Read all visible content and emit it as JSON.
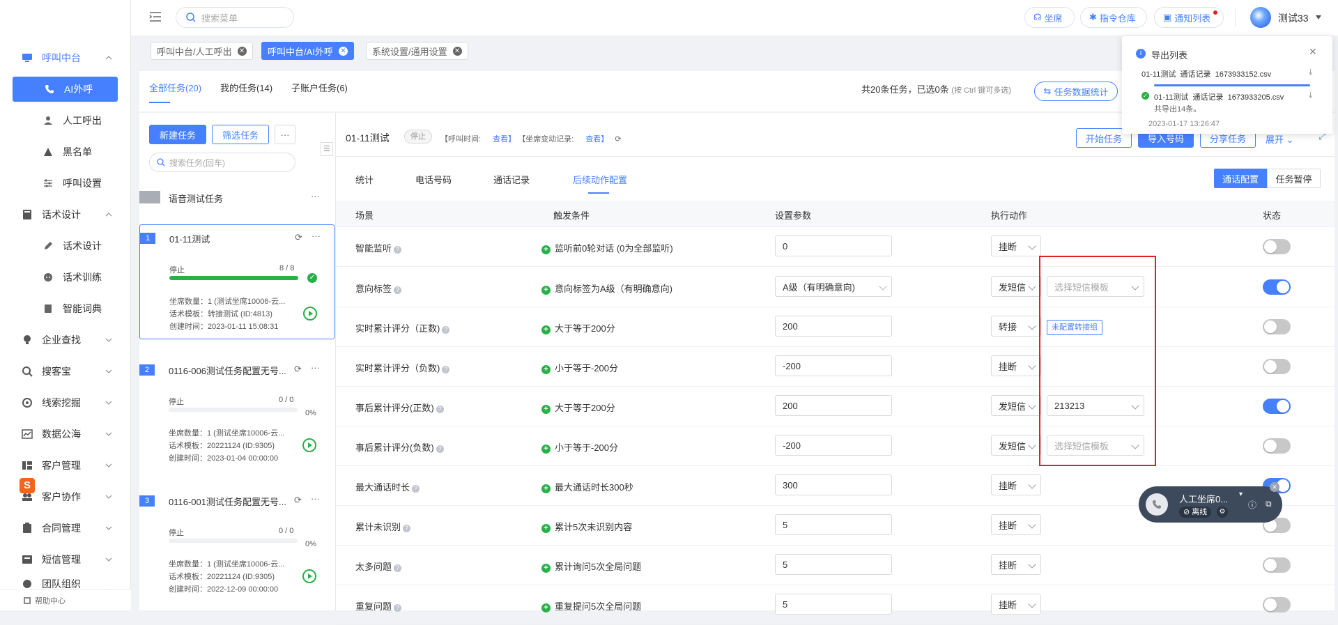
{
  "colors": {
    "accent": "#4680ff",
    "success": "#27b148",
    "alert": "#e02020"
  },
  "header": {
    "search_placeholder": "搜索菜单",
    "pill_agent": "坐席",
    "pill_commands": "指令仓库",
    "pill_notify": "通知列表",
    "user_name": "测试33"
  },
  "sidebar": {
    "groups": [
      {
        "label": "呼叫中台"
      },
      {
        "label": "AI外呼"
      },
      {
        "label": "人工呼出"
      },
      {
        "label": "黑名单"
      },
      {
        "label": "呼叫设置"
      },
      {
        "label": "话术设计"
      },
      {
        "label": "话术设计"
      },
      {
        "label": "话术训练"
      },
      {
        "label": "智能词典"
      },
      {
        "label": "企业查找"
      },
      {
        "label": "搜客宝"
      },
      {
        "label": "线索挖掘"
      },
      {
        "label": "数据公海"
      },
      {
        "label": "客户管理"
      },
      {
        "label": "客户协作"
      },
      {
        "label": "合同管理"
      },
      {
        "label": "短信管理"
      },
      {
        "label": "团队组织"
      }
    ],
    "help": "帮助中心"
  },
  "tags": [
    "呼叫中台/人工呼出",
    "呼叫中台/AI外呼",
    "系统设置/通用设置"
  ],
  "tabs": {
    "all": "全部任务(20)",
    "mine": "我的任务(14)",
    "sub": "子账户任务(6)"
  },
  "summary": {
    "text": "共20条任务，已选0条",
    "hint": "(按 Ctrl 键可多选)",
    "stats_button": "任务数据统计"
  },
  "left": {
    "new_task": "新建任务",
    "filter_task": "筛选任务",
    "search_placeholder": "搜索任务(回车)",
    "group_name": "语音测试任务"
  },
  "tasks": [
    {
      "num": "1",
      "name": "01-11测试",
      "status": "停止",
      "progress_text": "8 / 8",
      "progress": 1.0,
      "percent": "",
      "agents": "坐席数量：1 (测试坐席10006-云...",
      "template": "话术模板：转接测试 (ID:4813)",
      "created": "创建时间：2023-01-11 15:08:31"
    },
    {
      "num": "2",
      "name": "0116-006测试任务配置无号...",
      "status": "停止",
      "progress_text": "0 / 0",
      "progress": 0,
      "percent": "0%",
      "agents": "坐席数量：1 (测试坐席10006-云...",
      "template": "话术模板：20221124 (ID:9305)",
      "created": "创建时间：2023-01-04 00:00:00"
    },
    {
      "num": "3",
      "name": "0116-001测试任务配置无号...",
      "status": "停止",
      "progress_text": "0 / 0",
      "progress": 0,
      "percent": "0%",
      "agents": "坐席数量：1 (测试坐席10006-云...",
      "template": "话术模板：20221124 (ID:9305)",
      "created": "创建时间：2022-12-09 00:00:00"
    }
  ],
  "main": {
    "task_title": "01-11测试",
    "task_status": "停止",
    "call_time_label": "【呼叫时间:",
    "call_time_link": "查看】",
    "agent_change_label": "【坐席变动记录:",
    "agent_change_link": "查看】",
    "btn_start": "开始任务",
    "btn_import": "导入号码",
    "btn_share": "分享任务",
    "btn_expand": "展开",
    "subtabs": [
      "统计",
      "电话号码",
      "通话记录",
      "后续动作配置"
    ],
    "btn_call_config": "通话配置",
    "btn_pause": "任务暂停",
    "columns": [
      "场景",
      "触发条件",
      "设置参数",
      "执行动作",
      "状态"
    ],
    "rows": [
      {
        "scene": "智能监听",
        "cond": "监听前0轮对话 (0为全部监听)",
        "param": "0",
        "action": "挂断",
        "extra": "",
        "on": false
      },
      {
        "scene": "意向标签",
        "cond": "意向标签为A级（有明确意向)",
        "param": "A级（有明确意向)",
        "action": "发短信",
        "extra": "选择短信模板",
        "on": true
      },
      {
        "scene": "实时累计评分（正数)",
        "cond": "大于等于200分",
        "param": "200",
        "action": "转接",
        "extra": "未配置转接组",
        "on": false
      },
      {
        "scene": "实时累计评分（负数)",
        "cond": "小于等于-200分",
        "param": "-200",
        "action": "挂断",
        "extra": "",
        "on": false
      },
      {
        "scene": "事后累计评分(正数)",
        "cond": "大于等于200分",
        "param": "200",
        "action": "发短信",
        "extra": "213213",
        "on": true
      },
      {
        "scene": "事后累计评分(负数)",
        "cond": "小于等于-200分",
        "param": "-200",
        "action": "发短信",
        "extra": "选择短信模板",
        "on": false
      },
      {
        "scene": "最大通话时长",
        "cond": "最大通话时长300秒",
        "param": "300",
        "action": "挂断",
        "extra": "",
        "on": true
      },
      {
        "scene": "累计未识别",
        "cond": "累计5次未识别内容",
        "param": "5",
        "action": "挂断",
        "extra": "",
        "on": false
      },
      {
        "scene": "太多问题",
        "cond": "累计询问5次全局问题",
        "param": "5",
        "action": "挂断",
        "extra": "",
        "on": false
      },
      {
        "scene": "重复问题",
        "cond": "重复提问5次全局问题",
        "param": "5",
        "action": "挂断",
        "extra": "",
        "on": false
      }
    ]
  },
  "export": {
    "title": "导出列表",
    "item1_name": "01-11测试",
    "item1_type": "通话记录",
    "item1_file": "1673933152.csv",
    "item2_name": "01-11测试",
    "item2_type": "通话记录",
    "item2_file": "1673933205.csv",
    "item2_count": "共导出14条。",
    "item2_time": "2023-01-17 13:26:47"
  },
  "phone_widget": {
    "name": "人工坐席0...",
    "status": "离线"
  }
}
